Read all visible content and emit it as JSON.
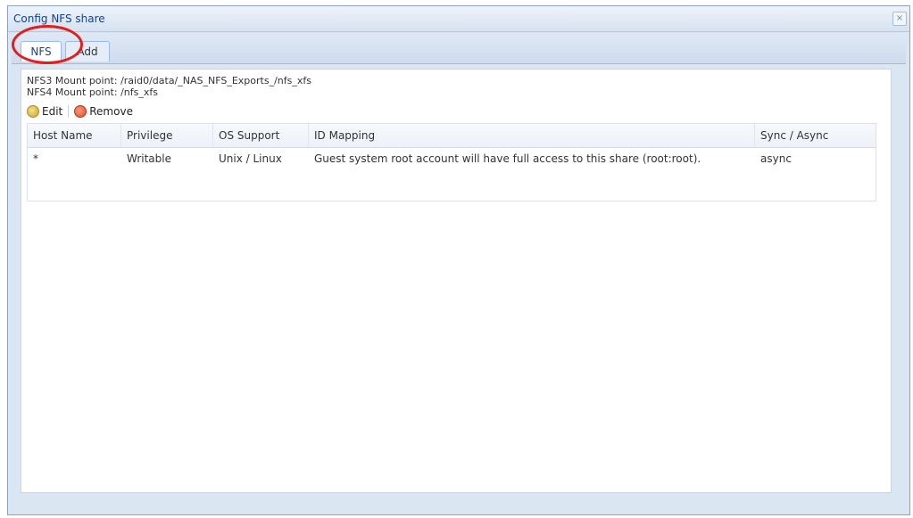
{
  "window": {
    "title": "Config NFS share",
    "close_glyph": "×"
  },
  "tabs": [
    {
      "label": "NFS"
    },
    {
      "label": "Add"
    }
  ],
  "mount_points": {
    "nfs3": "NFS3 Mount point: /raid0/data/_NAS_NFS_Exports_/nfs_xfs",
    "nfs4": "NFS4 Mount point: /nfs_xfs"
  },
  "toolbar": {
    "edit_label": "Edit",
    "remove_label": "Remove"
  },
  "table": {
    "columns": [
      "Host Name",
      "Privilege",
      "OS Support",
      "ID Mapping",
      "Sync / Async"
    ],
    "rows": [
      [
        "*",
        "Writable",
        "Unix / Linux",
        "Guest system root account will have full access to this share (root:root).",
        "async"
      ]
    ]
  },
  "colors": {
    "accent": "#15428b",
    "highlight_circle": "#e02020"
  }
}
